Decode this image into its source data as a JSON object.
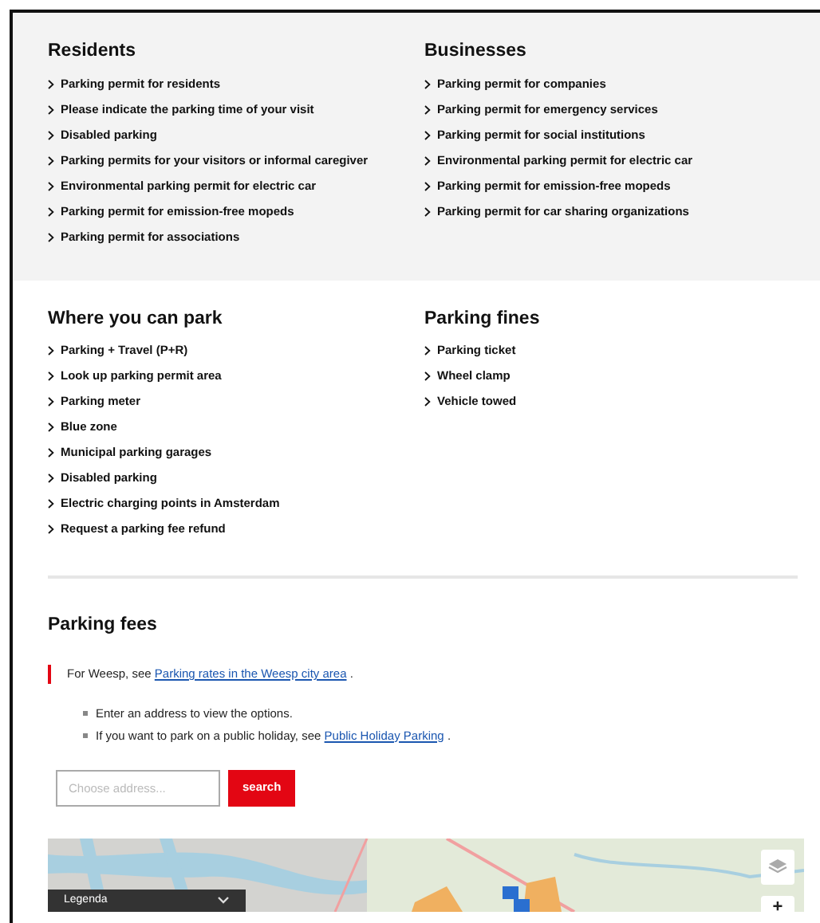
{
  "top_sections": [
    {
      "heading": "Residents",
      "links": [
        "Parking permit for residents",
        "Please indicate the parking time of your visit",
        "Disabled parking",
        "Parking permits for your visitors or informal caregiver",
        "Environmental parking permit for electric car",
        "Parking permit for emission-free mopeds",
        "Parking permit for associations"
      ]
    },
    {
      "heading": "Businesses",
      "links": [
        "Parking permit for companies",
        "Parking permit for emergency services",
        "Parking permit for social institutions",
        "Environmental parking permit for electric car",
        "Parking permit for emission-free mopeds",
        "Parking permit for car sharing organizations"
      ]
    }
  ],
  "middle_sections": [
    {
      "heading": "Where you can park",
      "links": [
        "Parking + Travel (P+R)",
        "Look up parking permit area",
        "Parking meter",
        "Blue zone",
        "Municipal parking garages",
        "Disabled parking",
        "Electric charging points in Amsterdam",
        "Request a parking fee refund"
      ]
    },
    {
      "heading": "Parking fines",
      "links": [
        "Parking ticket",
        "Wheel clamp",
        "Vehicle towed"
      ]
    }
  ],
  "fees": {
    "heading": "Parking fees",
    "callout": {
      "text": "For Weesp, see",
      "link": "Parking rates in the Weesp city area",
      "after": "."
    },
    "bullets": [
      {
        "text": "Enter an address to view the options."
      },
      {
        "text": "If you want to park on a public holiday, see",
        "link": "Public Holiday Parking",
        "after": "."
      }
    ],
    "address_field": {
      "placeholder": "Choose address..."
    },
    "search_button": "search",
    "map": {
      "legend": "Legenda",
      "zoom_in": "+"
    }
  }
}
